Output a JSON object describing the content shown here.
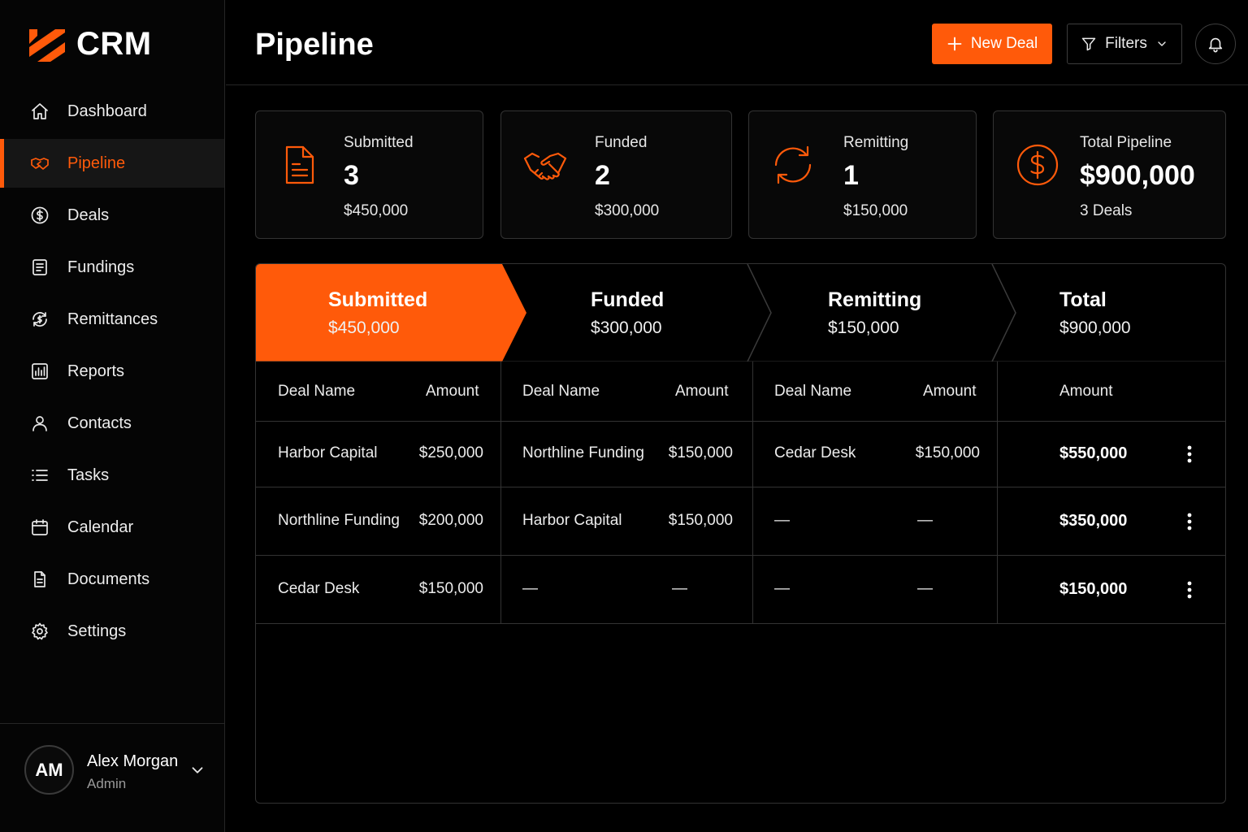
{
  "app": {
    "logo_text": "CRM"
  },
  "colors": {
    "accent": "#ff5a0a",
    "background": "#000000"
  },
  "sidebar": {
    "items": [
      {
        "label": "Dashboard",
        "icon": "home-icon"
      },
      {
        "label": "Pipeline",
        "icon": "handshake-icon",
        "active": true
      },
      {
        "label": "Deals",
        "icon": "dollar-circle-icon"
      },
      {
        "label": "Fundings",
        "icon": "document-icon"
      },
      {
        "label": "Remittances",
        "icon": "dollar-refresh-icon"
      },
      {
        "label": "Reports",
        "icon": "bar-chart-icon"
      },
      {
        "label": "Contacts",
        "icon": "user-icon"
      },
      {
        "label": "Tasks",
        "icon": "list-icon"
      },
      {
        "label": "Calendar",
        "icon": "calendar-icon"
      },
      {
        "label": "Documents",
        "icon": "file-icon"
      },
      {
        "label": "Settings",
        "icon": "gear-icon"
      }
    ],
    "user": {
      "initials": "AM",
      "name": "Alex Morgan",
      "role": "Admin"
    }
  },
  "header": {
    "title": "Pipeline",
    "new_deal_label": "New Deal",
    "filters_label": "Filters"
  },
  "stats": [
    {
      "label": "Submitted",
      "value": "3",
      "sub": "$450,000",
      "icon": "document-icon"
    },
    {
      "label": "Funded",
      "value": "2",
      "sub": "$300,000",
      "icon": "handshake-icon"
    },
    {
      "label": "Remitting",
      "value": "1",
      "sub": "$150,000",
      "icon": "refresh-icon"
    },
    {
      "label": "Total Pipeline",
      "value": "$900,000",
      "sub": "3 Deals",
      "icon": "dollar-circle-icon"
    }
  ],
  "stages": [
    {
      "name": "Submitted",
      "amount": "$450,000"
    },
    {
      "name": "Funded",
      "amount": "$300,000"
    },
    {
      "name": "Remitting",
      "amount": "$150,000"
    },
    {
      "name": "Total",
      "amount": "$900,000"
    }
  ],
  "table": {
    "headers": {
      "deal_name": "Deal Name",
      "amount": "Amount"
    },
    "rows": [
      {
        "submitted": {
          "name": "Harbor Capital",
          "amount": "$250,000"
        },
        "funded": {
          "name": "Northline Funding",
          "amount": "$150,000"
        },
        "remitting": {
          "name": "Cedar Desk",
          "amount": "$150,000"
        },
        "total": "$550,000"
      },
      {
        "submitted": {
          "name": "Northline Funding",
          "amount": "$200,000"
        },
        "funded": {
          "name": "Harbor Capital",
          "amount": "$150,000"
        },
        "remitting": {
          "name": "—",
          "amount": "—"
        },
        "total": "$350,000"
      },
      {
        "submitted": {
          "name": "Cedar Desk",
          "amount": "$150,000"
        },
        "funded": {
          "name": "—",
          "amount": "—"
        },
        "remitting": {
          "name": "—",
          "amount": "—"
        },
        "total": "$150,000"
      }
    ]
  }
}
